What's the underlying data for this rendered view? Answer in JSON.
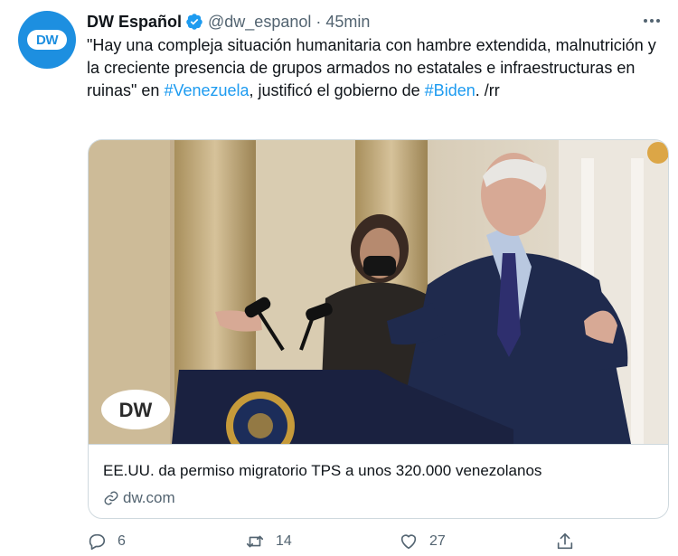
{
  "author": {
    "avatar_text": "DW",
    "display_name": "DW Español",
    "handle": "@dw_espanol",
    "separator": "·",
    "time": "45min"
  },
  "tweet": {
    "text_before": "\"Hay una compleja situación humanitaria con hambre extendida, malnutrición y la creciente presencia de grupos armados no estatales e infraestructuras en ruinas\" en ",
    "hashtag_1": "#Venezuela",
    "text_middle": ", justificó el gobierno de ",
    "hashtag_2": "#Biden",
    "text_after": ". /rr"
  },
  "card": {
    "image_watermark": "DW",
    "title": "EE.UU. da permiso migratorio TPS a unos 320.000 venezolanos",
    "domain": "dw.com"
  },
  "actions": {
    "reply_count": "6",
    "retweet_count": "14",
    "like_count": "27"
  },
  "colors": {
    "accent": "#1d9bf0",
    "brand": "#1d8fe0",
    "secondary_text": "#536471",
    "border": "#cfd9de"
  },
  "icons": [
    "verified-icon",
    "more-icon",
    "link-icon",
    "reply-icon",
    "retweet-icon",
    "like-icon",
    "share-icon"
  ]
}
